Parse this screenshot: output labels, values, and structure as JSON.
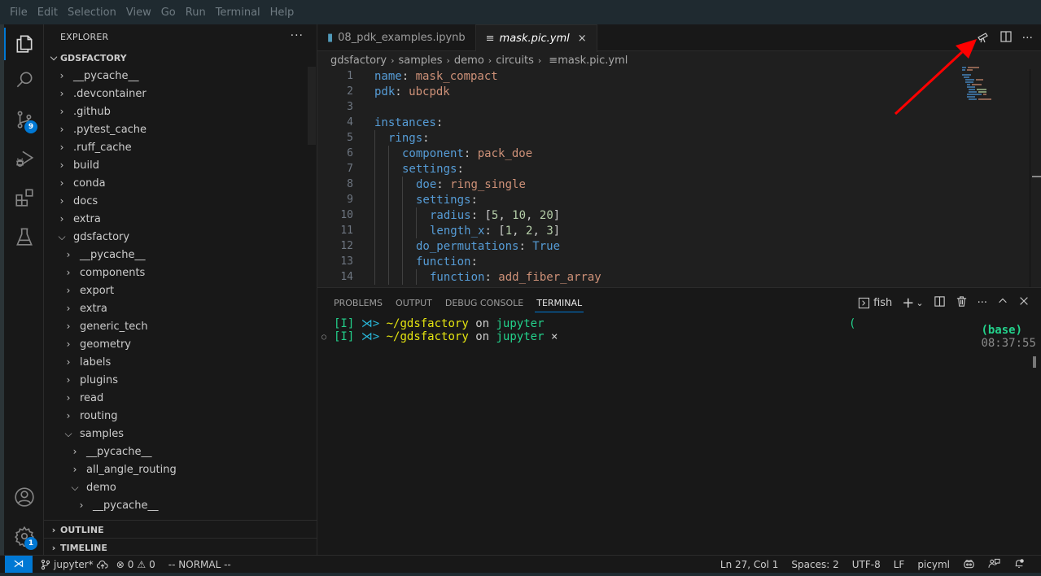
{
  "menu": [
    "File",
    "Edit",
    "Selection",
    "View",
    "Go",
    "Run",
    "Terminal",
    "Help"
  ],
  "activity_bar": {
    "items": [
      {
        "name": "explorer",
        "icon": "files-icon",
        "active": true
      },
      {
        "name": "search",
        "icon": "search-icon"
      },
      {
        "name": "source-control",
        "icon": "source-control-icon",
        "badge": "9"
      },
      {
        "name": "run-debug",
        "icon": "run-debug-icon"
      },
      {
        "name": "extensions",
        "icon": "extensions-icon"
      },
      {
        "name": "testing",
        "icon": "flask-icon"
      }
    ],
    "bottom": [
      {
        "name": "accounts",
        "icon": "account-icon"
      },
      {
        "name": "manage",
        "icon": "gear-icon",
        "badge": "1"
      }
    ]
  },
  "sidebar": {
    "title": "EXPLORER",
    "more": "···",
    "root": "GDSFACTORY",
    "tree": [
      {
        "label": "__pycache__",
        "depth": 0,
        "expanded": false
      },
      {
        "label": ".devcontainer",
        "depth": 0,
        "expanded": false
      },
      {
        "label": ".github",
        "depth": 0,
        "expanded": false
      },
      {
        "label": ".pytest_cache",
        "depth": 0,
        "expanded": false
      },
      {
        "label": ".ruff_cache",
        "depth": 0,
        "expanded": false
      },
      {
        "label": "build",
        "depth": 0,
        "expanded": false
      },
      {
        "label": "conda",
        "depth": 0,
        "expanded": false
      },
      {
        "label": "docs",
        "depth": 0,
        "expanded": false
      },
      {
        "label": "extra",
        "depth": 0,
        "expanded": false
      },
      {
        "label": "gdsfactory",
        "depth": 0,
        "expanded": true
      },
      {
        "label": "__pycache__",
        "depth": 1,
        "expanded": false
      },
      {
        "label": "components",
        "depth": 1,
        "expanded": false
      },
      {
        "label": "export",
        "depth": 1,
        "expanded": false
      },
      {
        "label": "extra",
        "depth": 1,
        "expanded": false
      },
      {
        "label": "generic_tech",
        "depth": 1,
        "expanded": false
      },
      {
        "label": "geometry",
        "depth": 1,
        "expanded": false
      },
      {
        "label": "labels",
        "depth": 1,
        "expanded": false
      },
      {
        "label": "plugins",
        "depth": 1,
        "expanded": false
      },
      {
        "label": "read",
        "depth": 1,
        "expanded": false
      },
      {
        "label": "routing",
        "depth": 1,
        "expanded": false
      },
      {
        "label": "samples",
        "depth": 1,
        "expanded": true
      },
      {
        "label": "__pycache__",
        "depth": 2,
        "expanded": false
      },
      {
        "label": "all_angle_routing",
        "depth": 2,
        "expanded": false
      },
      {
        "label": "demo",
        "depth": 2,
        "expanded": true
      },
      {
        "label": "__pycache__",
        "depth": 3,
        "expanded": false
      }
    ],
    "outline": "OUTLINE",
    "timeline": "TIMELINE"
  },
  "editor": {
    "tabs": [
      {
        "label": "08_pdk_examples.ipynb",
        "icon": "notebook-icon",
        "active": false
      },
      {
        "label": "mask.pic.yml",
        "icon": "file-lines-icon",
        "active": true,
        "close": "×"
      }
    ],
    "actions": [
      {
        "name": "telescope-button",
        "icon": "telescope-icon"
      },
      {
        "name": "split-editor-button",
        "icon": "split-icon"
      },
      {
        "name": "more-actions-button",
        "icon": "ellipsis-icon"
      }
    ],
    "breadcrumb": [
      "gdsfactory",
      "samples",
      "demo",
      "circuits",
      "mask.pic.yml"
    ],
    "lines": [
      {
        "n": "1",
        "indent": 0,
        "key": "name",
        "value": "mask_compact",
        "vtype": "v"
      },
      {
        "n": "2",
        "indent": 0,
        "key": "pdk",
        "value": "ubcpdk",
        "vtype": "v"
      },
      {
        "n": "3",
        "indent": 0,
        "key": "",
        "value": "",
        "vtype": ""
      },
      {
        "n": "4",
        "indent": 0,
        "key": "instances",
        "value": "",
        "vtype": ""
      },
      {
        "n": "5",
        "indent": 1,
        "key": "rings",
        "value": "",
        "vtype": ""
      },
      {
        "n": "6",
        "indent": 2,
        "key": "component",
        "value": "pack_doe",
        "vtype": "v"
      },
      {
        "n": "7",
        "indent": 2,
        "key": "settings",
        "value": "",
        "vtype": ""
      },
      {
        "n": "8",
        "indent": 3,
        "key": "doe",
        "value": "ring_single",
        "vtype": "v"
      },
      {
        "n": "9",
        "indent": 3,
        "key": "settings",
        "value": "",
        "vtype": ""
      },
      {
        "n": "10",
        "indent": 4,
        "key": "radius",
        "value": "[5, 10, 20]",
        "vtype": "list"
      },
      {
        "n": "11",
        "indent": 4,
        "key": "length_x",
        "value": "[1, 2, 3]",
        "vtype": "list"
      },
      {
        "n": "12",
        "indent": 3,
        "key": "do_permutations",
        "value": "True",
        "vtype": "k"
      },
      {
        "n": "13",
        "indent": 3,
        "key": "function",
        "value": "",
        "vtype": ""
      },
      {
        "n": "14",
        "indent": 4,
        "key": "function",
        "value": "add_fiber_array",
        "vtype": "v"
      }
    ]
  },
  "panel": {
    "tabs": [
      "PROBLEMS",
      "OUTPUT",
      "DEBUG CONSOLE",
      "TERMINAL"
    ],
    "active_tab": "TERMINAL",
    "terminal_name": "fish",
    "actions": {
      "new": "+",
      "dropdown": "⌄",
      "split": "split",
      "kill": "trash",
      "more": "···",
      "maximize": "^",
      "close": "×"
    },
    "terminal_lines": [
      {
        "mode": "[I]",
        "arrow": "⋊>",
        "path": "~/gdsfactory",
        "on": "on",
        "branch": "jupyter",
        "suffix": "",
        "right_paren": "(",
        "decorated": false
      },
      {
        "mode": "[I]",
        "arrow": "⋊>",
        "path": "~/gdsfactory",
        "on": "on",
        "branch": "jupyter",
        "suffix": "×",
        "env": "(base)",
        "time": "08:37:55",
        "decorated": true
      }
    ]
  },
  "statusbar": {
    "remote_icon": "remote-icon",
    "branch": "jupyter*",
    "sync_icon": "cloud-upload-icon",
    "errors": "0",
    "warnings": "0",
    "mode": "-- NORMAL --",
    "position": "Ln 27, Col 1",
    "spaces": "Spaces: 2",
    "encoding": "UTF-8",
    "eol": "LF",
    "language": "picyml"
  },
  "annotation": {
    "type": "arrow",
    "color": "#ff0000",
    "points_to": "telescope-button"
  }
}
